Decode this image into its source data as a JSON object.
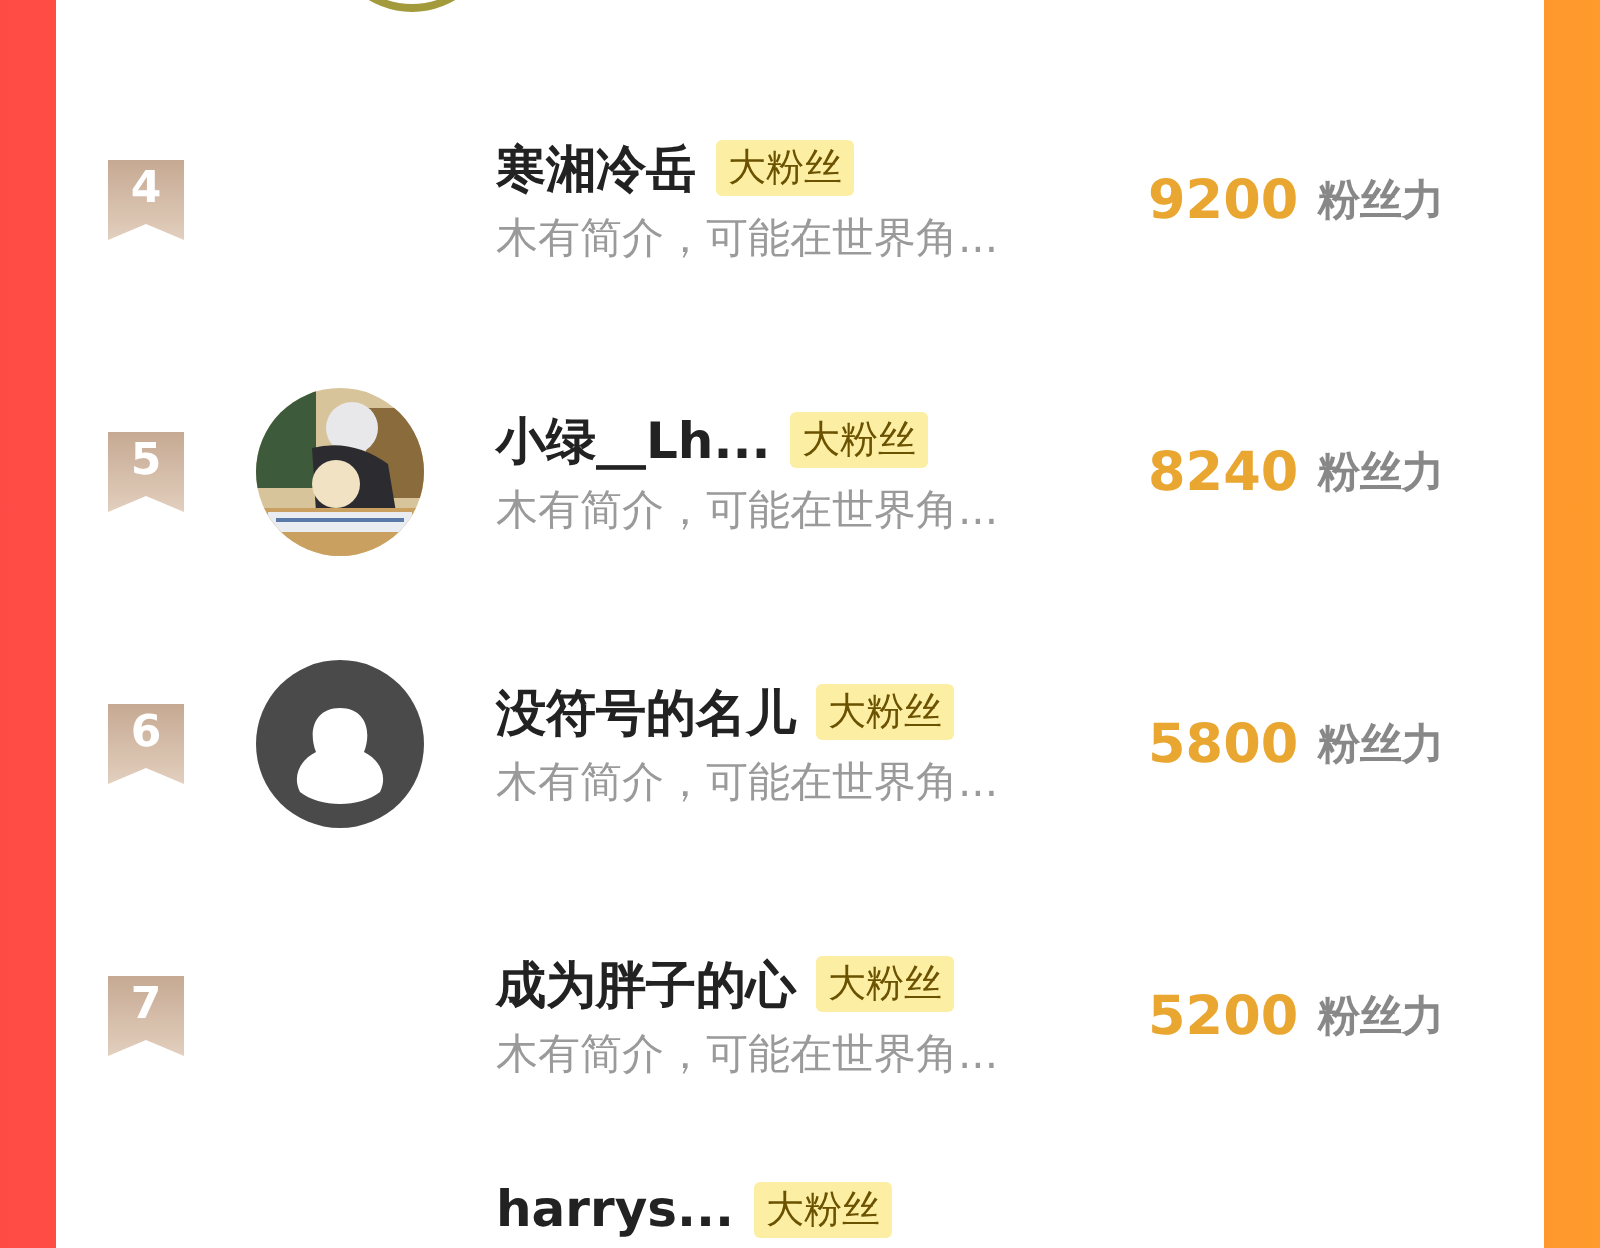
{
  "top_avatar": {
    "kind": "ring"
  },
  "rows": [
    {
      "rank": "4",
      "name": "寒湘冷岳",
      "tag": "大粉丝",
      "bio": "木有简介，可能在世界角...",
      "score": "9200",
      "unit": "粉丝力"
    },
    {
      "rank": "5",
      "name": "小绿__Lh...",
      "tag": "大粉丝",
      "bio": "木有简介，可能在世界角...",
      "score": "8240",
      "unit": "粉丝力"
    },
    {
      "rank": "6",
      "avatar": {
        "kind": "default"
      },
      "name": "没符号的名儿",
      "tag": "大粉丝",
      "bio": "木有简介，可能在世界角...",
      "score": "5800",
      "unit": "粉丝力"
    },
    {
      "rank": "7",
      "name": "成为胖子的心",
      "tag": "大粉丝",
      "bio": "木有简介，可能在世界角...",
      "score": "5200",
      "unit": "粉丝力"
    },
    {
      "name": "harrys...",
      "tag": "大粉丝"
    }
  ]
}
